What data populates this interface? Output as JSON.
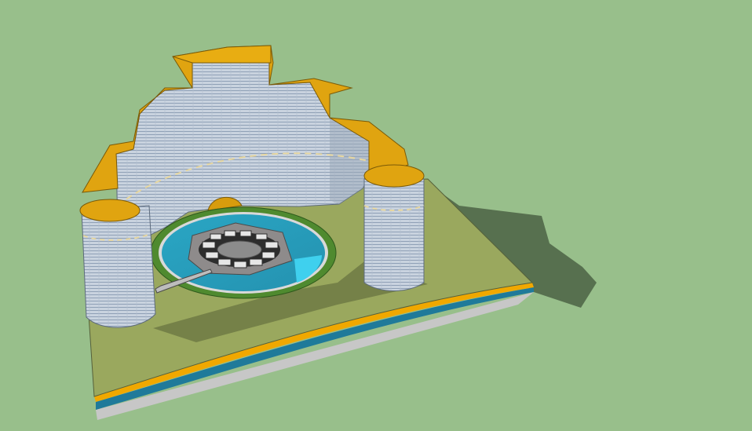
{
  "scene": {
    "description_visible": "",
    "colors": {
      "sky": "#98bf8b",
      "ground": "#9aa85e",
      "wall_face": "#c9d3df",
      "wall_top": "#e0a410",
      "water": "#2aa6c4",
      "water_light": "#3fd0ee",
      "ring_grass": "#4f8a2f",
      "platform": "#8e8b8b",
      "base_edge_orange": "#f0a800",
      "base_edge_blue": "#1f7a9a",
      "base_edge_gray": "#c7c7c7",
      "shadow": "#57704f"
    },
    "objects": [
      {
        "name": "curved-wall",
        "material": "tiled"
      },
      {
        "name": "left-tower"
      },
      {
        "name": "right-tower"
      },
      {
        "name": "pool"
      },
      {
        "name": "central-platform"
      },
      {
        "name": "walkway-bridge"
      },
      {
        "name": "ground-plinth"
      }
    ]
  }
}
